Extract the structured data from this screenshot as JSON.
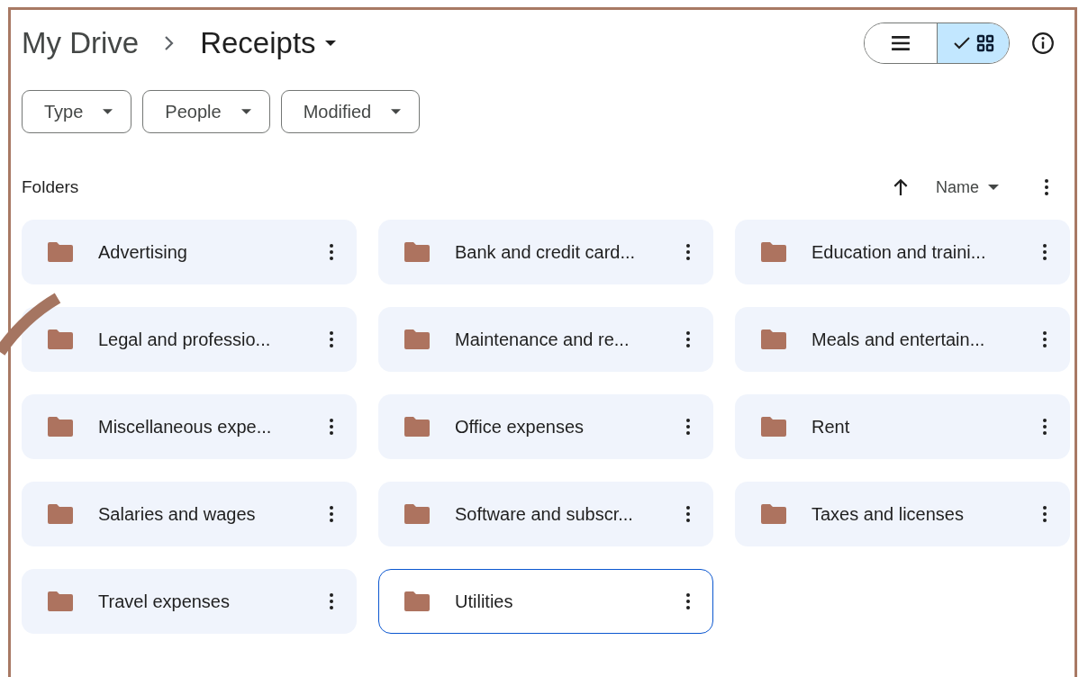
{
  "breadcrumb": [
    {
      "label": "My Drive",
      "current": false
    },
    {
      "label": "Receipts",
      "current": true
    }
  ],
  "view_toggle": [
    {
      "kind": "list",
      "selected": false
    },
    {
      "kind": "grid",
      "selected": true
    }
  ],
  "filters": [
    {
      "label": "Type"
    },
    {
      "label": "People"
    },
    {
      "label": "Modified"
    }
  ],
  "section_title": "Folders",
  "sort": {
    "label": "Name"
  },
  "folders": [
    {
      "name": "Advertising",
      "selected": false
    },
    {
      "name": "Bank and credit card...",
      "selected": false
    },
    {
      "name": "Education and traini...",
      "selected": false
    },
    {
      "name": "Legal and professio...",
      "selected": false
    },
    {
      "name": "Maintenance and re...",
      "selected": false
    },
    {
      "name": "Meals and entertain...",
      "selected": false
    },
    {
      "name": "Miscellaneous expe...",
      "selected": false
    },
    {
      "name": "Office expenses",
      "selected": false
    },
    {
      "name": "Rent",
      "selected": false
    },
    {
      "name": "Salaries and wages",
      "selected": false
    },
    {
      "name": "Software and subscr...",
      "selected": false
    },
    {
      "name": "Taxes and licenses",
      "selected": false
    },
    {
      "name": "Travel expenses",
      "selected": false
    },
    {
      "name": "Utilities",
      "selected": true
    }
  ]
}
